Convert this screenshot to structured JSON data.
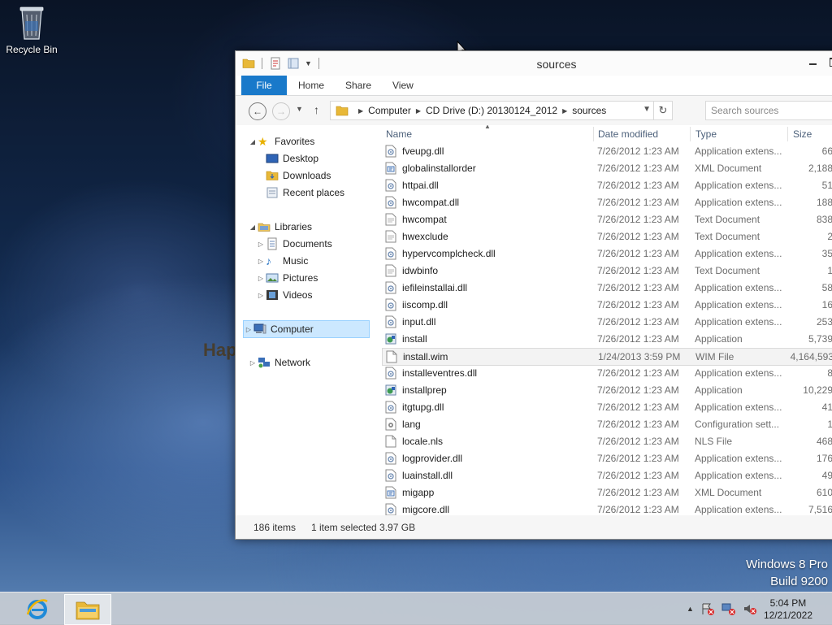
{
  "desktop": {
    "recycle_bin_label": "Recycle Bin",
    "watermark_line1": "Windows 8 Pro",
    "watermark_line2": "Build 9200",
    "background_text": "Hap"
  },
  "window": {
    "title": "sources",
    "ribbon_tabs": [
      "File",
      "Home",
      "Share",
      "View"
    ],
    "address": {
      "crumbs": [
        "Computer",
        "CD Drive (D:) 20130124_2012",
        "sources"
      ]
    },
    "search_placeholder": "Search sources",
    "nav_pane": {
      "favorites_label": "Favorites",
      "favorites": [
        "Desktop",
        "Downloads",
        "Recent places"
      ],
      "libraries_label": "Libraries",
      "libraries": [
        "Documents",
        "Music",
        "Pictures",
        "Videos"
      ],
      "computer_label": "Computer",
      "network_label": "Network"
    },
    "columns": [
      "Name",
      "Date modified",
      "Type",
      "Size"
    ],
    "files": [
      {
        "name": "fveupg.dll",
        "date": "7/26/2012 1:23 AM",
        "type": "Application extens...",
        "size": "66",
        "icon": "dll-icon"
      },
      {
        "name": "globalinstallorder",
        "date": "7/26/2012 1:23 AM",
        "type": "XML Document",
        "size": "2,188",
        "icon": "xml-icon"
      },
      {
        "name": "httpai.dll",
        "date": "7/26/2012 1:23 AM",
        "type": "Application extens...",
        "size": "51",
        "icon": "dll-icon"
      },
      {
        "name": "hwcompat.dll",
        "date": "7/26/2012 1:23 AM",
        "type": "Application extens...",
        "size": "188",
        "icon": "dll-icon"
      },
      {
        "name": "hwcompat",
        "date": "7/26/2012 1:23 AM",
        "type": "Text Document",
        "size": "838",
        "icon": "text-icon"
      },
      {
        "name": "hwexclude",
        "date": "7/26/2012 1:23 AM",
        "type": "Text Document",
        "size": "2",
        "icon": "text-icon"
      },
      {
        "name": "hypervcomplcheck.dll",
        "date": "7/26/2012 1:23 AM",
        "type": "Application extens...",
        "size": "35",
        "icon": "dll-icon"
      },
      {
        "name": "idwbinfo",
        "date": "7/26/2012 1:23 AM",
        "type": "Text Document",
        "size": "1",
        "icon": "text-icon"
      },
      {
        "name": "iefileinstallai.dll",
        "date": "7/26/2012 1:23 AM",
        "type": "Application extens...",
        "size": "58",
        "icon": "dll-icon"
      },
      {
        "name": "iiscomp.dll",
        "date": "7/26/2012 1:23 AM",
        "type": "Application extens...",
        "size": "16",
        "icon": "dll-icon"
      },
      {
        "name": "input.dll",
        "date": "7/26/2012 1:23 AM",
        "type": "Application extens...",
        "size": "253",
        "icon": "dll-icon"
      },
      {
        "name": "install",
        "date": "7/26/2012 1:23 AM",
        "type": "Application",
        "size": "5,739",
        "icon": "app-icon"
      },
      {
        "name": "install.wim",
        "date": "1/24/2013 3:59 PM",
        "type": "WIM File",
        "size": "4,164,593",
        "icon": "blank-file-icon"
      },
      {
        "name": "installeventres.dll",
        "date": "7/26/2012 1:23 AM",
        "type": "Application extens...",
        "size": "8",
        "icon": "dll-icon"
      },
      {
        "name": "installprep",
        "date": "7/26/2012 1:23 AM",
        "type": "Application",
        "size": "10,229",
        "icon": "app-icon"
      },
      {
        "name": "itgtupg.dll",
        "date": "7/26/2012 1:23 AM",
        "type": "Application extens...",
        "size": "41",
        "icon": "dll-icon"
      },
      {
        "name": "lang",
        "date": "7/26/2012 1:23 AM",
        "type": "Configuration sett...",
        "size": "1",
        "icon": "config-icon"
      },
      {
        "name": "locale.nls",
        "date": "7/26/2012 1:23 AM",
        "type": "NLS File",
        "size": "468",
        "icon": "blank-file-icon"
      },
      {
        "name": "logprovider.dll",
        "date": "7/26/2012 1:23 AM",
        "type": "Application extens...",
        "size": "176",
        "icon": "dll-icon"
      },
      {
        "name": "luainstall.dll",
        "date": "7/26/2012 1:23 AM",
        "type": "Application extens...",
        "size": "49",
        "icon": "dll-icon"
      },
      {
        "name": "migapp",
        "date": "7/26/2012 1:23 AM",
        "type": "XML Document",
        "size": "610",
        "icon": "xml-icon"
      },
      {
        "name": "migcore.dll",
        "date": "7/26/2012 1:23 AM",
        "type": "Application extens...",
        "size": "7,516",
        "icon": "dll-icon"
      }
    ],
    "selected_file": "install.wim",
    "status": {
      "item_count": "186 items",
      "selection": "1 item selected  3.97 GB"
    }
  },
  "taskbar": {
    "time": "5:04 PM",
    "date": "12/21/2022"
  },
  "colors": {
    "file_tab": "#1979ca",
    "selection": "#cce8ff",
    "column_header_text": "#4c607a",
    "taskbar": "#c8cdd4"
  }
}
